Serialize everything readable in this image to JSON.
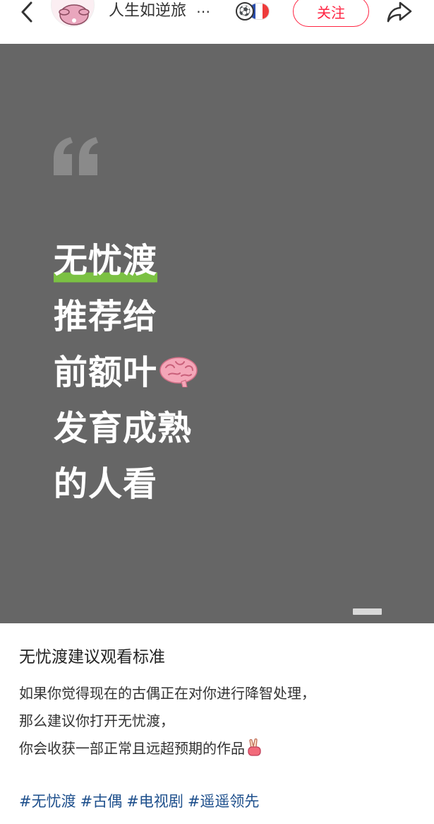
{
  "header": {
    "author_name": "人生如逆旅",
    "ellipsis": "⋯",
    "badge_ball": "⚽",
    "follow_label": "关注",
    "flag_colors": [
      "#2b4fb0",
      "#ffffff",
      "#ee3b3b"
    ],
    "accent_color": "#ff2442"
  },
  "image": {
    "background_color": "#666666",
    "headline_lines": [
      "无忧渡",
      "推荐给",
      "前额叶",
      "发育成熟",
      "的人看"
    ],
    "highlight_color": "#7bc143",
    "brain_icon": "brain-icon"
  },
  "note": {
    "title": "无忧渡建议观看标准",
    "body_lines": [
      "如果你觉得现在的古偶正在对你进行降智处理，",
      "那么建议你打开无忧渡，",
      "你会收获一部正常且远超预期的作品"
    ],
    "tags": [
      "#无忧渡",
      "#古偶",
      "#电视剧",
      "#遥遥领先"
    ],
    "tag_color": "#1d4f8c"
  }
}
